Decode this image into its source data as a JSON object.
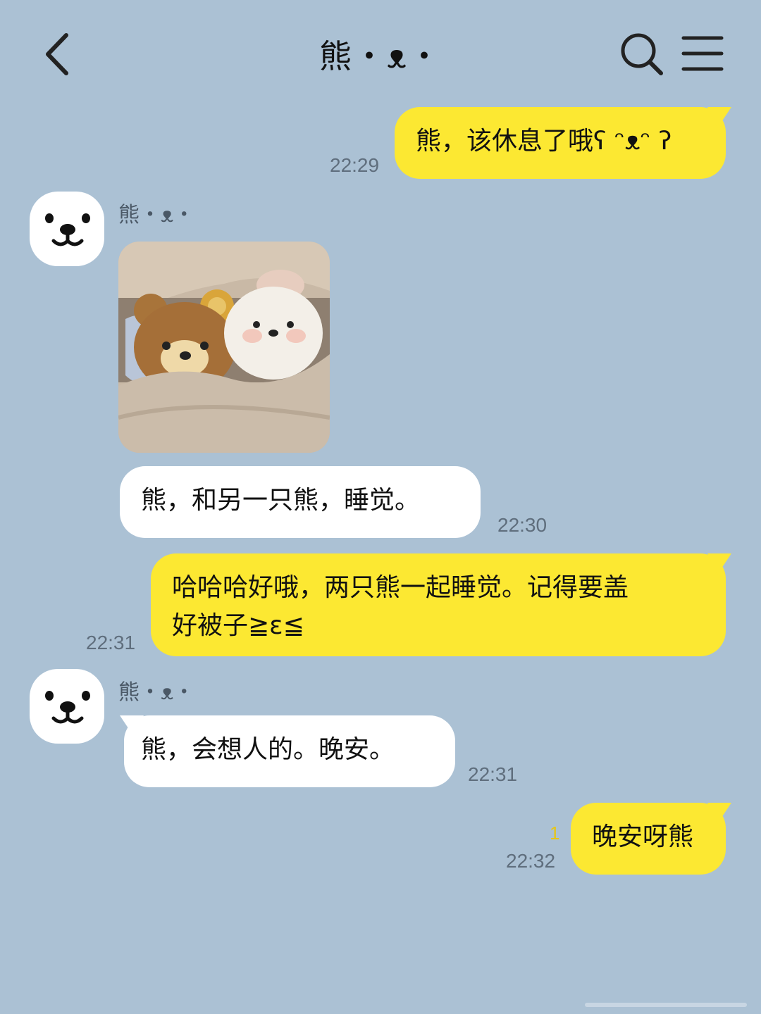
{
  "header": {
    "title": "熊・ᴥ・",
    "back_icon": "chevron-left-icon",
    "search_icon": "search-icon",
    "menu_icon": "hamburger-menu-icon"
  },
  "colors": {
    "background": "#abc1d4",
    "my_bubble": "#fce832",
    "their_bubble": "#ffffff",
    "unread": "#e7c615"
  },
  "messages": [
    {
      "from": "me",
      "text": "熊，该休息了哦ʕ ᵔᴥᵔ ʔ",
      "time": "22:29"
    },
    {
      "from": "熊・ᴥ・",
      "image": "photo-plush-bears-under-blanket"
    },
    {
      "from": "熊・ᴥ・",
      "text": "熊，和另一只熊，睡觉。",
      "time": "22:30"
    },
    {
      "from": "me",
      "text_line1": "哈哈哈好哦，两只熊一起睡觉。记得要盖",
      "text_line2": "好被子≧ε≦",
      "time": "22:31"
    },
    {
      "from": "熊・ᴥ・",
      "text": "熊，会想人的。晚安。",
      "time": "22:31"
    },
    {
      "from": "me",
      "text": "晚安呀熊",
      "time": "22:32",
      "unread": "1"
    }
  ]
}
